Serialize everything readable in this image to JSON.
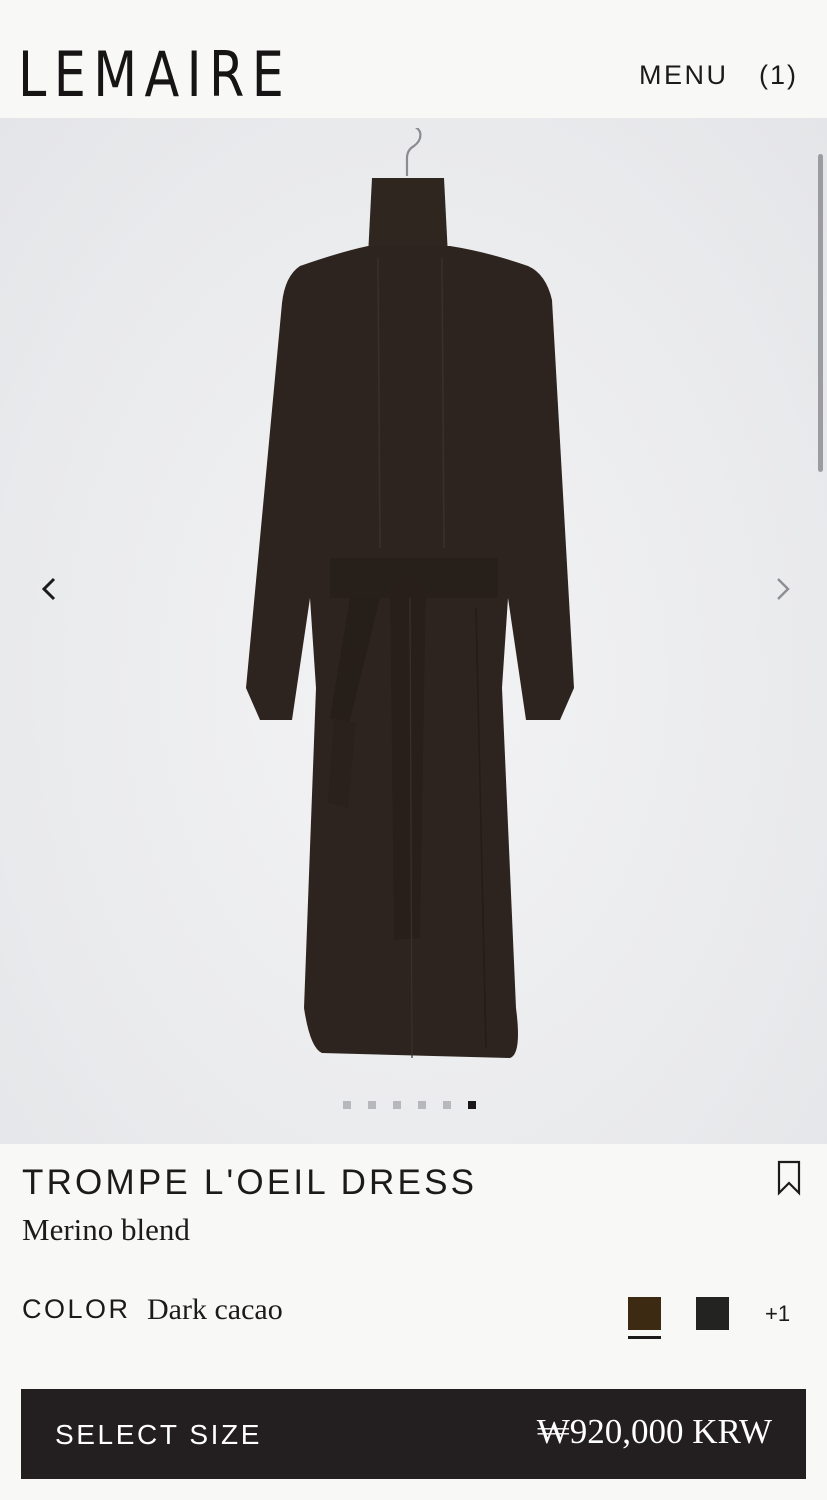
{
  "header": {
    "logo": "LEMAIRE",
    "menu_label": "MENU",
    "cart_label": "(1)"
  },
  "gallery": {
    "image_icon": "dress-product-image",
    "prev_icon": "chevron-left-icon",
    "next_icon": "chevron-right-icon",
    "slide_count": 6,
    "active_slide": 6
  },
  "product": {
    "name": "TROMPE L'OEIL DRESS",
    "material": "Merino blend",
    "bookmark_icon": "bookmark-icon"
  },
  "color": {
    "label": "COLOR",
    "value": "Dark cacao",
    "swatches": [
      {
        "name": "Dark cacao",
        "hex": "#3c2a12",
        "selected": true
      },
      {
        "name": "Black",
        "hex": "#232322",
        "selected": false
      }
    ],
    "more": "+1"
  },
  "purchase": {
    "select_label": "SELECT SIZE",
    "price": "₩920,000 KRW"
  },
  "colors": {
    "background": "#f8f8f6",
    "text": "#1d1a1b",
    "button": "#231f20",
    "button_text": "#ffffff"
  }
}
